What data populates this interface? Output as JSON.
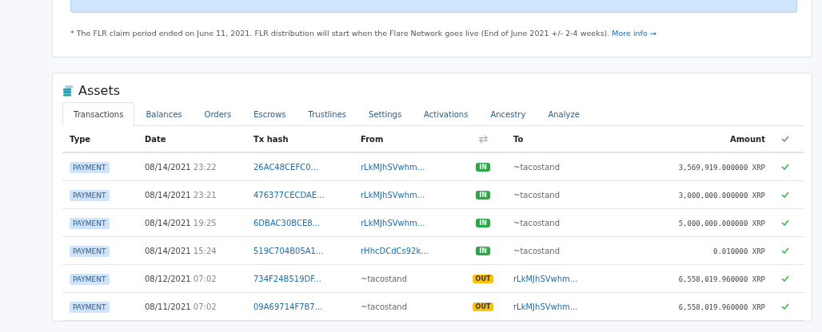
{
  "footnote": {
    "text": "* The FLR claim period ended on June 11, 2021. FLR distribution will start when the Flare Network goes live (End of June 2021 +/- 2-4 weeks).",
    "link": "More info →"
  },
  "assets": {
    "title": "Assets",
    "tabs": [
      {
        "label": "Transactions",
        "selected": true
      },
      {
        "label": "Balances",
        "selected": false
      },
      {
        "label": "Orders",
        "selected": false
      },
      {
        "label": "Escrows",
        "selected": false
      },
      {
        "label": "Trustlines",
        "selected": false
      },
      {
        "label": "Settings",
        "selected": false
      },
      {
        "label": "Activations",
        "selected": false
      },
      {
        "label": "Ancestry",
        "selected": false
      },
      {
        "label": "Analyze",
        "selected": false
      }
    ],
    "columns": [
      "Type",
      "Date",
      "Tx hash",
      "From",
      "To",
      "Amount"
    ],
    "rows": [
      {
        "type": "PAYMENT",
        "date": "08/14/2021",
        "time": "23:22",
        "hash": "26AC48CEFC0...",
        "from": "rLkMJhSVwhm...",
        "from_link": true,
        "direction": "IN",
        "to": "~tacostand",
        "to_link": false,
        "amount": "3,569,919.000000 XRP",
        "validated": true
      },
      {
        "type": "PAYMENT",
        "date": "08/14/2021",
        "time": "23:21",
        "hash": "476377CECDAE...",
        "from": "rLkMJhSVwhm...",
        "from_link": true,
        "direction": "IN",
        "to": "~tacostand",
        "to_link": false,
        "amount": "3,000,000.000000 XRP",
        "validated": true
      },
      {
        "type": "PAYMENT",
        "date": "08/14/2021",
        "time": "19:25",
        "hash": "6DBAC30BCE8...",
        "from": "rLkMJhSVwhm...",
        "from_link": true,
        "direction": "IN",
        "to": "~tacostand",
        "to_link": false,
        "amount": "5,000,000.000000 XRP",
        "validated": true
      },
      {
        "type": "PAYMENT",
        "date": "08/14/2021",
        "time": "15:24",
        "hash": "519C704B05A1...",
        "from": "rHhcDCdCs92k...",
        "from_link": true,
        "direction": "IN",
        "to": "~tacostand",
        "to_link": false,
        "amount": "0.010000 XRP",
        "validated": true
      },
      {
        "type": "PAYMENT",
        "date": "08/12/2021",
        "time": "07:02",
        "hash": "734F24B519DF...",
        "from": "~tacostand",
        "from_link": false,
        "direction": "OUT",
        "to": "rLkMJhSVwhm...",
        "to_link": true,
        "amount": "6,558,019.960000 XRP",
        "validated": true
      },
      {
        "type": "PAYMENT",
        "date": "08/11/2021",
        "time": "07:02",
        "hash": "09A69714F7B7...",
        "from": "~tacostand",
        "from_link": false,
        "direction": "OUT",
        "to": "rLkMJhSVwhm...",
        "to_link": true,
        "amount": "6,558,019.960000 XRP",
        "validated": true
      }
    ]
  }
}
